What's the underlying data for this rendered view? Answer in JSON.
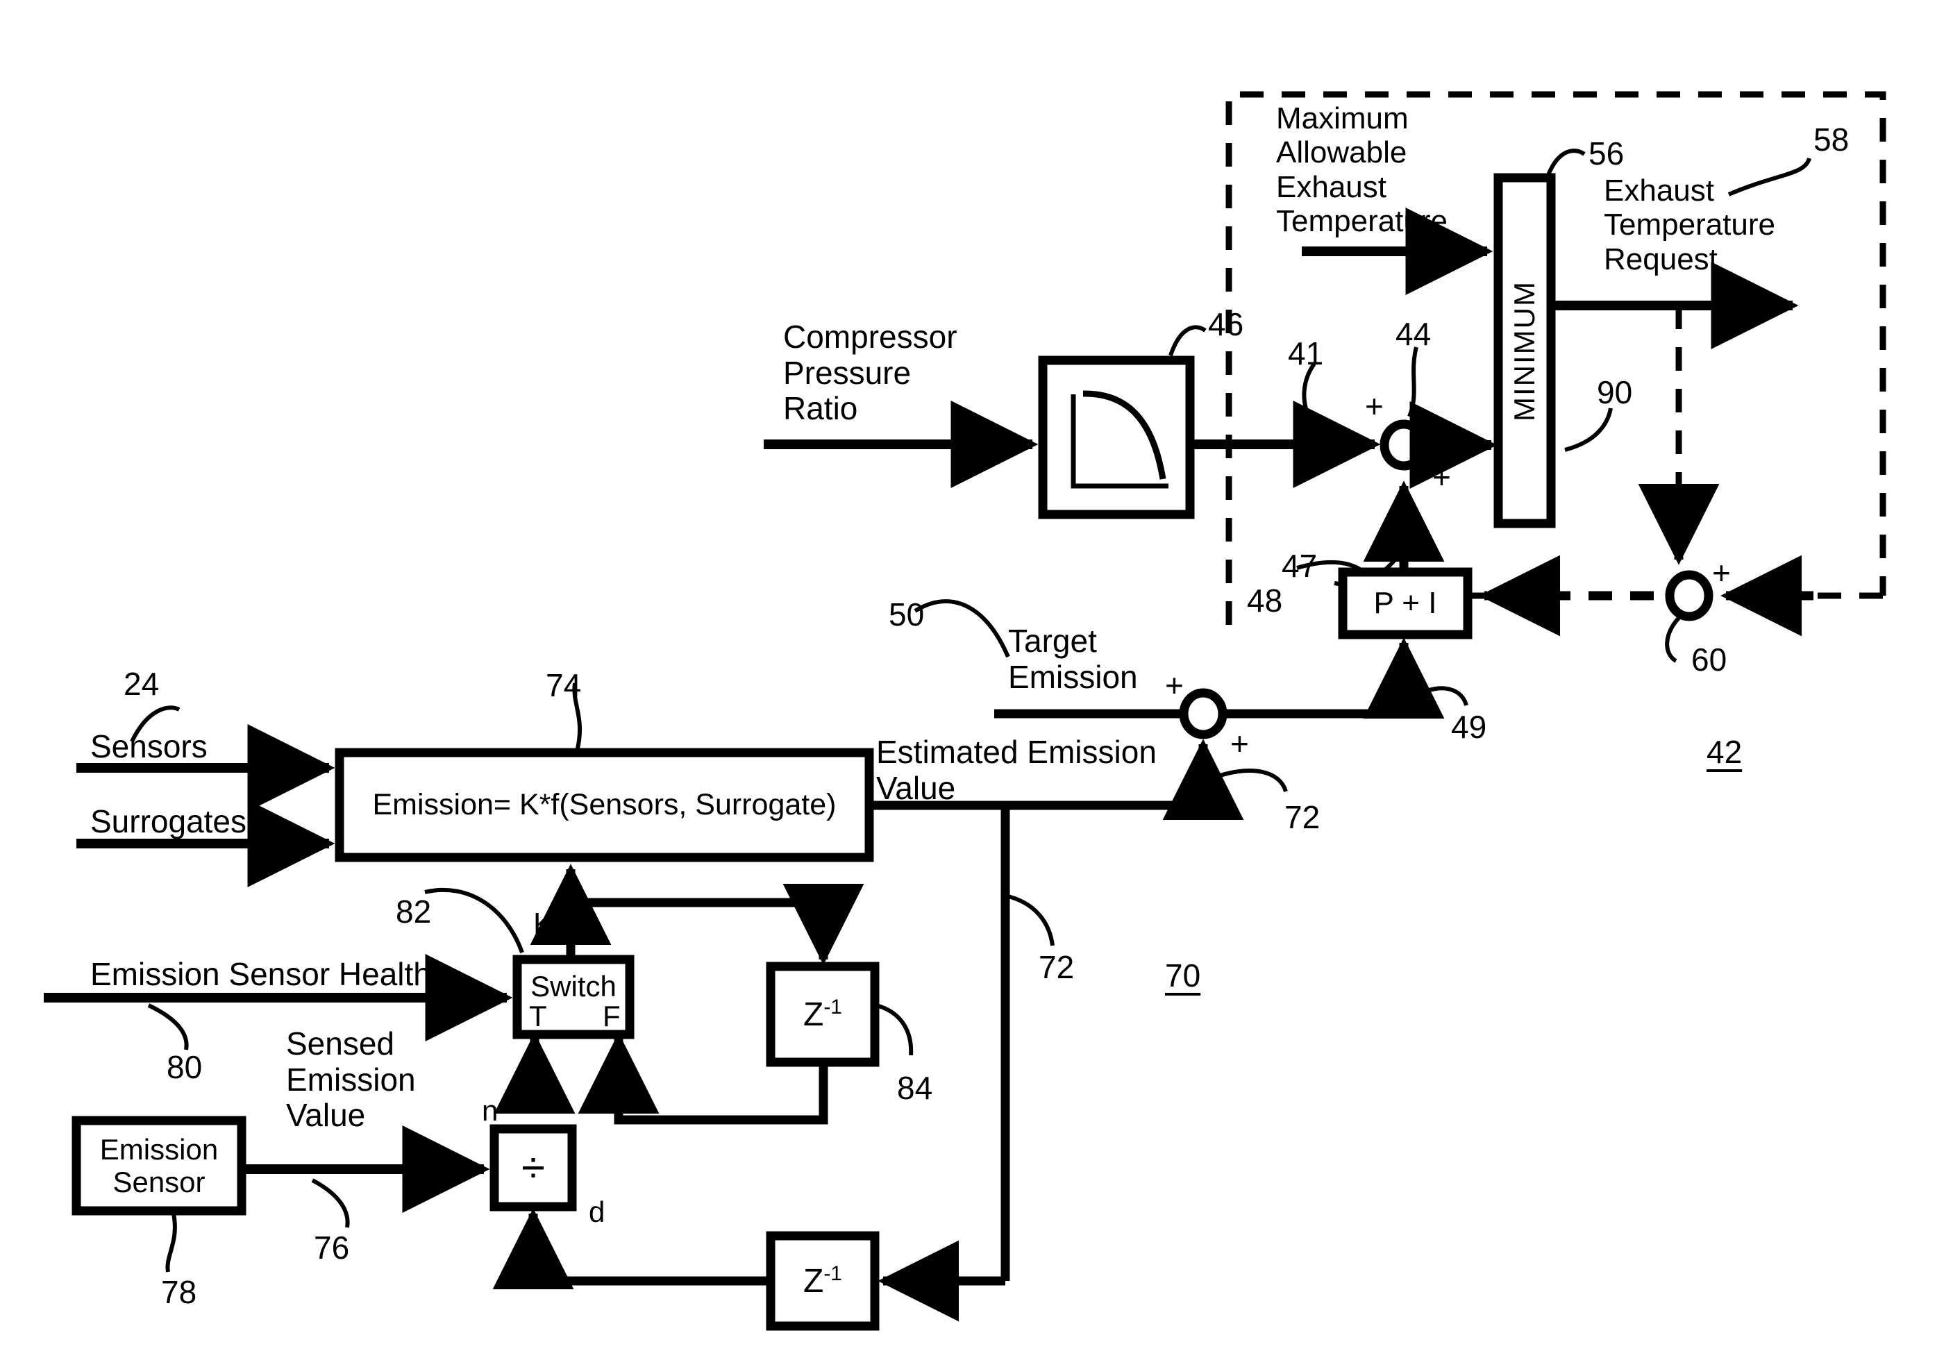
{
  "figure": {
    "title": "Emission control block diagram",
    "reference_numerals": {
      "sensors_group": "24",
      "outer_controller": "42",
      "summing_junction_44": "44",
      "signal_41": "41",
      "lookup_table_46": "46",
      "signal_47": "47",
      "pi_controller_48": "48",
      "signal_49": "49",
      "target_emission_50": "50",
      "minimum_block_56": "56",
      "exhaust_temp_request_58": "58",
      "feedback_junction_60": "60",
      "emission_estimator_group": "70",
      "estimated_emission_signal_72": "72",
      "estimated_emission_signal_72b": "72",
      "emission_equation_block_74": "74",
      "sensed_emission_signal_76": "76",
      "emission_sensor_78": "78",
      "emission_sensor_health_80": "80",
      "switch_block_82": "82",
      "unit_delay_84": "84",
      "minimum_output_90": "90"
    }
  },
  "signals": {
    "maximum_allowable_exhaust_temperature": "Maximum\nAllowable\nExhaust\nTemperature",
    "compressor_pressure_ratio": "Compressor\nPressure\nRatio",
    "exhaust_temperature_request": "Exhaust\nTemperature\nRequest",
    "target_emission": "Target\nEmission",
    "estimated_emission_value": "Estimated Emission\nValue",
    "sensors": "Sensors",
    "surrogates": "Surrogates",
    "emission_sensor_health": "Emission Sensor Health",
    "sensed_emission_value": "Sensed\nEmission\nValue"
  },
  "blocks": {
    "lookup_table": {
      "label": "",
      "ref": "46",
      "kind": "curve-lookup-table"
    },
    "minimum": {
      "label": "MINIMUM",
      "ref": "56"
    },
    "pi_controller": {
      "label": "P + I",
      "ref": "48"
    },
    "emission_equation": {
      "label": "Emission= K*f(Sensors, Surrogate)",
      "ref": "74"
    },
    "switch": {
      "label": "Switch",
      "ref": "82",
      "input_true": "T",
      "input_false": "F",
      "output": "K"
    },
    "unit_delay_upper": {
      "label": "Z-1",
      "label_base": "Z",
      "label_exp": "-1",
      "ref": "84"
    },
    "unit_delay_lower": {
      "label": "Z-1",
      "label_base": "Z",
      "label_exp": "-1"
    },
    "divide": {
      "label": "÷",
      "numerator": "n",
      "denominator": "d"
    },
    "emission_sensor": {
      "label": "Emission\nSensor",
      "ref": "78"
    }
  },
  "operators": {
    "plus_44_left": "+",
    "plus_44_bottom": "+",
    "plus_50_top": "+",
    "plus_50_bottom": "+",
    "plus_60": "+"
  },
  "colors": {
    "ink": "#000000",
    "paper": "#ffffff"
  }
}
